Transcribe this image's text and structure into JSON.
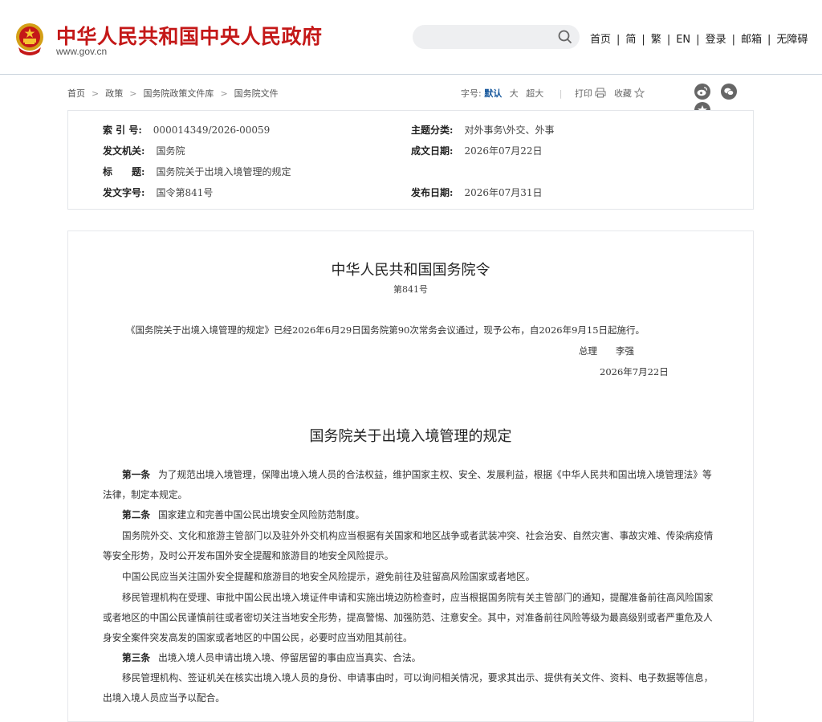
{
  "header": {
    "site_title": "中华人民共和国中央人民政府",
    "site_url": "www.gov.cn",
    "search_placeholder": "",
    "nav": [
      "首页",
      "简",
      "繁",
      "EN",
      "登录",
      "邮箱",
      "无障碍"
    ]
  },
  "breadcrumb": [
    "首页",
    "政策",
    "国务院政策文件库",
    "国务院文件"
  ],
  "tools": {
    "font_label": "字号:",
    "font_default": "默认",
    "font_large": "大",
    "font_xlarge": "超大",
    "print": "打印",
    "favorite": "收藏"
  },
  "social_icons": [
    "weibo-icon",
    "wechat-icon",
    "star-share-icon"
  ],
  "meta": {
    "index_label": "索 引 号:",
    "index_value": "000014349/2026-00059",
    "topic_label": "主题分类:",
    "topic_value": "对外事务\\外交、外事",
    "issuer_label": "发文机关:",
    "issuer_value": "国务院",
    "created_label": "成文日期:",
    "created_value": "2026年07月22日",
    "title_label": "标　　题:",
    "title_value": "国务院关于出境入境管理的规定",
    "docno_label": "发文字号:",
    "docno_value": "国令第841号",
    "published_label": "发布日期:",
    "published_value": "2026年07月31日"
  },
  "document": {
    "order_title": "中华人民共和国国务院令",
    "order_no": "第841号",
    "preamble": "《国务院关于出境入境管理的规定》已经2026年6月29日国务院第90次常务会议通过，现予公布，自2026年9月15日起施行。",
    "signer": "总理　　李强",
    "sign_date": "2026年7月22日",
    "regulation_title": "国务院关于出境入境管理的规定",
    "paragraphs": [
      {
        "lead": "第一条",
        "text": "为了规范出境入境管理，保障出境入境人员的合法权益，维护国家主权、安全、发展利益，根据《中华人民共和国出境入境管理法》等法律，制定本规定。"
      },
      {
        "lead": "第二条",
        "text": "国家建立和完善中国公民出境安全风险防范制度。"
      },
      {
        "lead": "",
        "text": "国务院外交、文化和旅游主管部门以及驻外外交机构应当根据有关国家和地区战争或者武装冲突、社会治安、自然灾害、事故灾难、传染病疫情等安全形势，及时公开发布国外安全提醒和旅游目的地安全风险提示。"
      },
      {
        "lead": "",
        "text": "中国公民应当关注国外安全提醒和旅游目的地安全风险提示，避免前往及驻留高风险国家或者地区。"
      },
      {
        "lead": "",
        "text": "移民管理机构在受理、审批中国公民出境入境证件申请和实施出境边防检查时，应当根据国务院有关主管部门的通知，提醒准备前往高风险国家或者地区的中国公民谨慎前往或者密切关注当地安全形势，提高警惕、加强防范、注意安全。其中，对准备前往风险等级为最高级别或者严重危及人身安全案件突发高发的国家或者地区的中国公民，必要时应当劝阻其前往。"
      },
      {
        "lead": "第三条",
        "text": "出境入境人员申请出境入境、停留居留的事由应当真实、合法。"
      },
      {
        "lead": "",
        "text": "移民管理机构、签证机关在核实出境入境人员的身份、申请事由时，可以询问相关情况，要求其出示、提供有关文件、资料、电子数据等信息，出境入境人员应当予以配合。"
      }
    ]
  },
  "colors": {
    "brand_red": "#c41818",
    "active_blue": "#1a5a9e"
  }
}
